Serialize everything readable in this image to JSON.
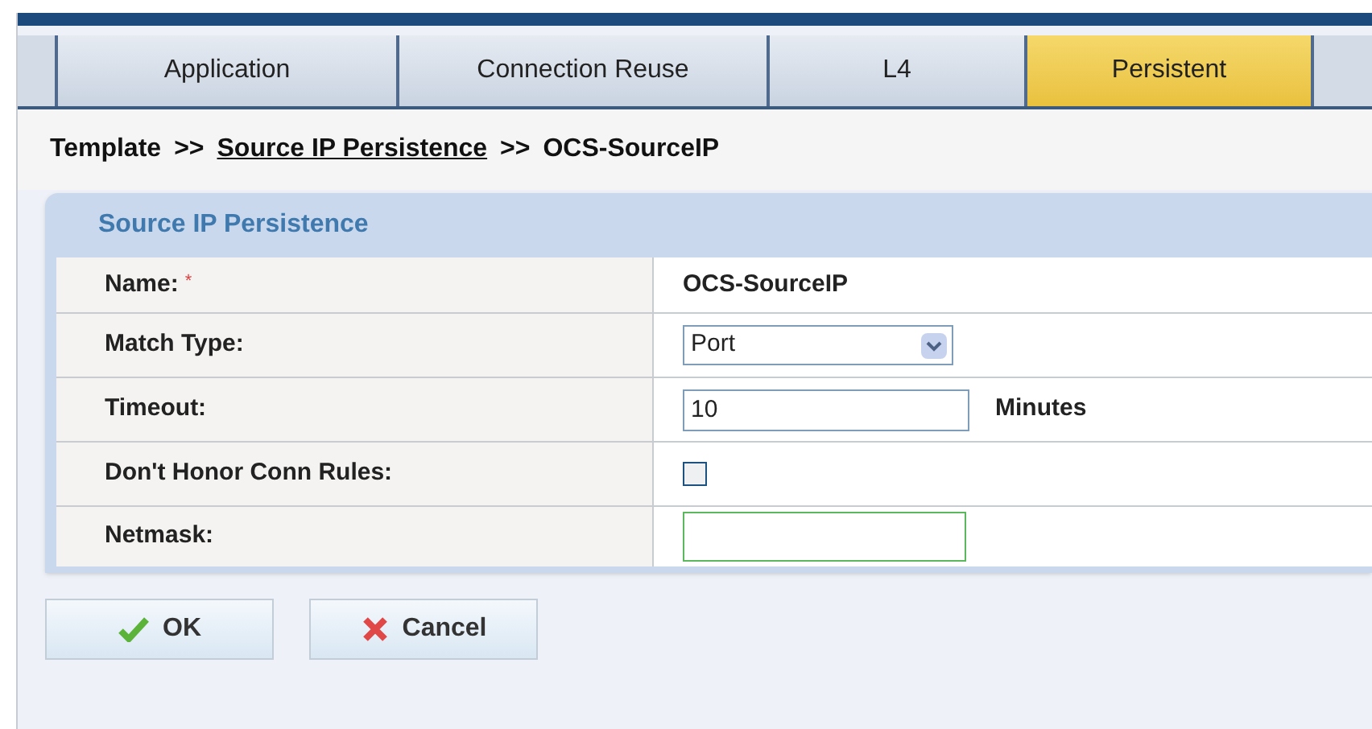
{
  "tabs": [
    {
      "label": "Application",
      "selected": false
    },
    {
      "label": "Connection Reuse",
      "selected": false
    },
    {
      "label": "L4",
      "selected": false
    },
    {
      "label": "Persistent",
      "selected": true
    }
  ],
  "breadcrumb": [
    {
      "label": "Template",
      "link": false
    },
    {
      "label": ">>",
      "link": false
    },
    {
      "label": "Source IP Persistence",
      "link": true
    },
    {
      "label": ">>",
      "link": false
    },
    {
      "label": "OCS-SourceIP",
      "link": false
    }
  ],
  "panel": {
    "title": "Source IP Persistence",
    "rows": [
      {
        "label": "Name:",
        "required_mark": "*",
        "kind": "text",
        "value": "OCS-SourceIP"
      },
      {
        "label": "Match Type:",
        "kind": "select",
        "value": "Port"
      },
      {
        "label": "Timeout:",
        "kind": "input_unit",
        "value": "10",
        "unit": "Minutes"
      },
      {
        "label": "Don't Honor Conn Rules:",
        "kind": "checkbox",
        "checked": false
      },
      {
        "label": "Netmask:",
        "kind": "input"
      }
    ]
  },
  "buttons": [
    {
      "label": "OK",
      "kind": "ok"
    },
    {
      "label": "Cancel",
      "kind": "cancel"
    }
  ]
}
